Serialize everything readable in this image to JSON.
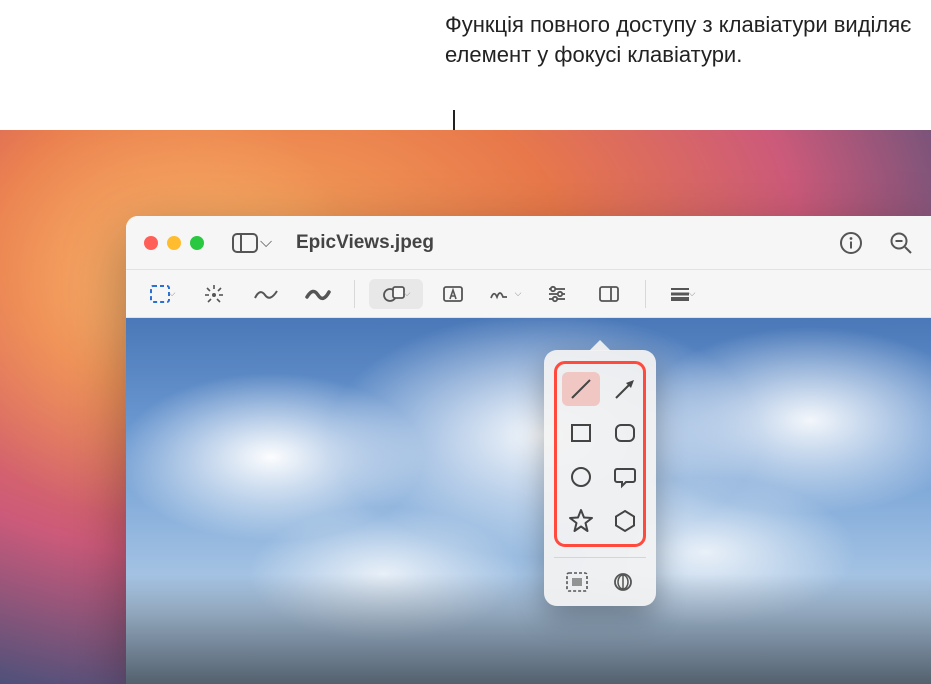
{
  "callout": {
    "text": "Функція повного доступу з клавіатури виділяє елемент у фокусі клавіатури."
  },
  "window": {
    "title": "EpicViews.jpeg"
  },
  "icons": {
    "sidebar": "sidebar-icon",
    "info": "info-icon",
    "zoom_out": "zoom-out-icon",
    "selection": "selection-icon",
    "instant_alpha": "instant-alpha-icon",
    "sketch": "sketch-icon",
    "draw": "draw-icon",
    "shapes": "shapes-icon",
    "text": "text-icon",
    "sign": "sign-icon",
    "adjust": "adjust-color-icon",
    "crop": "crop-icon",
    "border": "border-style-icon",
    "line": "line-icon",
    "arrow": "arrow-icon",
    "rect": "rectangle-icon",
    "roundrect": "rounded-rectangle-icon",
    "oval": "oval-icon",
    "speech": "speech-bubble-icon",
    "star": "star-icon",
    "polygon": "polygon-icon",
    "mask": "mask-icon",
    "loupe": "loupe-icon"
  }
}
